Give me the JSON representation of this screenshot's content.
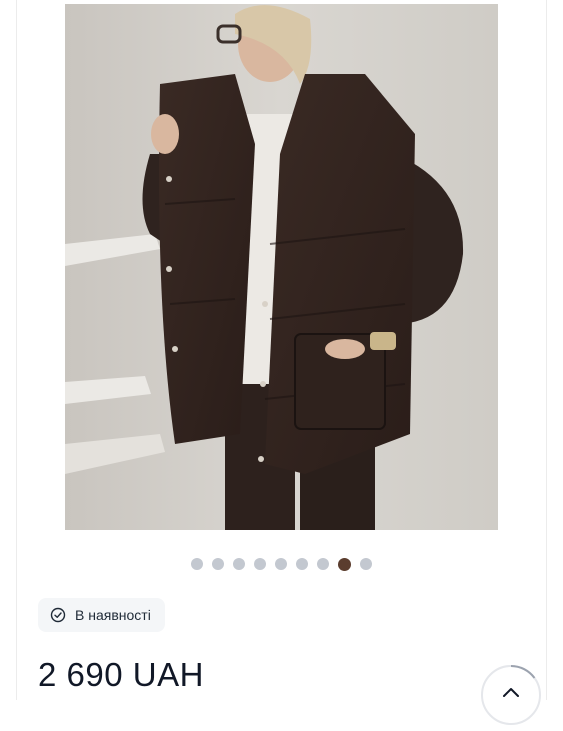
{
  "gallery": {
    "slide_count": 9,
    "active_index": 7
  },
  "availability": {
    "label": "В наявності",
    "icon": "check-circle-icon"
  },
  "price": {
    "text": "2 690 UAH"
  },
  "scroll_top": {
    "icon": "chevron-up-icon",
    "progress": 0.15
  }
}
